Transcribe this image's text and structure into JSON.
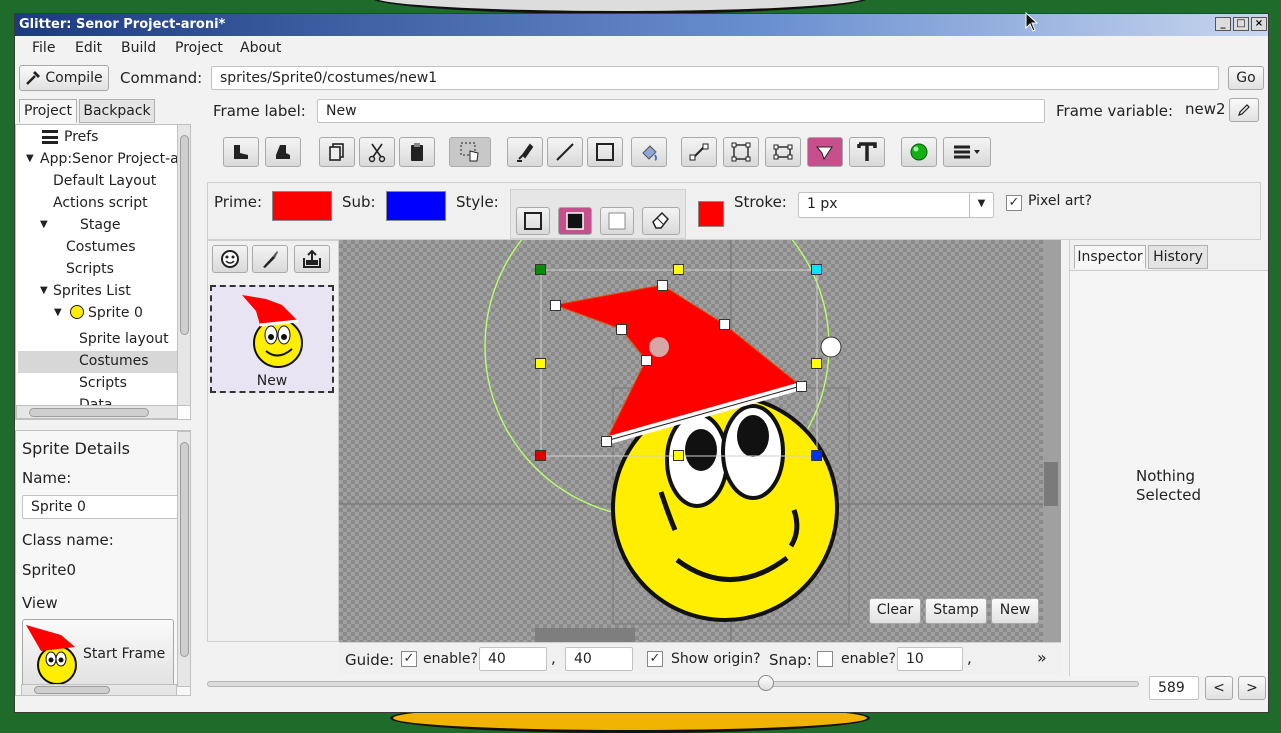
{
  "window": {
    "title": "Glitter: Senor Project-aroni*"
  },
  "menu": [
    "File",
    "Edit",
    "Build",
    "Project",
    "About"
  ],
  "toolbar": {
    "compile_label": "Compile",
    "command_label": "Command:",
    "command_value": "sprites/Sprite0/costumes/new1",
    "go_label": "Go"
  },
  "left_tabs": [
    "Project",
    "Backpack"
  ],
  "tree": [
    {
      "label": "Prefs"
    },
    {
      "label": "App:Senor Project-ar"
    },
    {
      "label": "Default Layout"
    },
    {
      "label": "Actions script"
    },
    {
      "label": "Stage"
    },
    {
      "label": "Costumes"
    },
    {
      "label": "Scripts"
    },
    {
      "label": "Sprites List"
    },
    {
      "label": "Sprite 0"
    },
    {
      "label": "Sprite layout"
    },
    {
      "label": "Costumes"
    },
    {
      "label": "Scripts"
    },
    {
      "label": "Data"
    }
  ],
  "sprite_details": {
    "heading": "Sprite Details",
    "name_label": "Name:",
    "name_value": "Sprite 0",
    "class_label": "Class name:",
    "class_value": "Sprite0",
    "view_label": "View",
    "start_frame_label": "Start Frame"
  },
  "frame": {
    "label_caption": "Frame label:",
    "label_value": "New",
    "variable_caption": "Frame variable:",
    "variable_value": "new2"
  },
  "style_bar": {
    "prime_label": "Prime:",
    "prime_color": "#ff0000",
    "sub_label": "Sub:",
    "sub_color": "#0000ff",
    "style_label": "Style:",
    "stroke_color": "#ff0000",
    "stroke_label": "Stroke:",
    "stroke_value": "1 px",
    "pixel_art_label": "Pixel art?"
  },
  "costume": {
    "label": "New"
  },
  "canvas_buttons": {
    "clear": "Clear",
    "stamp": "Stamp",
    "new": "New"
  },
  "guide_bar": {
    "guide_label": "Guide:",
    "enable_label": "enable?",
    "guide_x": "40",
    "comma1": ",",
    "guide_y": "40",
    "show_origin_label": "Show origin?",
    "snap_label": "Snap:",
    "snap_enable_label": "enable?",
    "snap_value": "10",
    "comma2": ",",
    "more": "»"
  },
  "right_tabs": [
    "Inspector",
    "History"
  ],
  "inspector": {
    "empty_line1": "Nothing",
    "empty_line2": "Selected"
  },
  "zoom": {
    "value": "589",
    "prev": "<",
    "next": ">",
    "slider_fraction": 0.6
  }
}
